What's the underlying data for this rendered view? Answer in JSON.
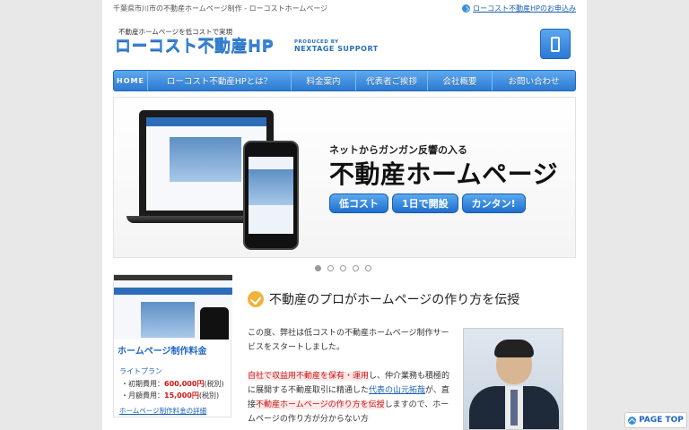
{
  "header": {
    "tagline": "千葉県市川市の不動産ホームページ制作 - ローコストホームページ",
    "apply_link": "ローコスト不動産HPのお申込み"
  },
  "logo": {
    "tag": "不動産ホームページを低コストで実現",
    "main": "ローコスト不動産HP",
    "partner_small": "PRODUCED BY",
    "partner_big": "NEXTAGE SUPPORT"
  },
  "nav": {
    "items": [
      {
        "label": "HOME"
      },
      {
        "label": "ローコスト不動産HPとは？"
      },
      {
        "label": "料金案内"
      },
      {
        "label": "代表者ご挨拶"
      },
      {
        "label": "会社概要"
      },
      {
        "label": "お問い合わせ"
      }
    ]
  },
  "hero": {
    "subtitle": "ネットからガンガン反響の入る",
    "title": "不動産ホームページ",
    "badges": [
      "低コスト",
      "1日で開設",
      "カンタン!"
    ]
  },
  "promo": {
    "title": "ホームページ制作料金",
    "plan": "ライトプラン",
    "initial_label": "・初期費用：",
    "initial_amount": "600,000円",
    "initial_tax": "(税別)",
    "monthly_label": "・月額費用：",
    "monthly_amount": "15,000円",
    "monthly_tax": "(税別)",
    "detail_link": "ホームページ制作料金の詳細"
  },
  "main": {
    "section_title": "不動産のプロがホームページの作り方を伝授",
    "p1": "この度、弊社は低コストの不動産ホームページ制作サービスをスタートしました。",
    "hl1": "自社で収益用不動産を保有・運用",
    "p2a": "し、仲介業務も積極的に展開する不動産取引に精通した",
    "link_rep": "代表の山元拓哉",
    "p2b": "が、直接",
    "hl2": "不動産ホームページの作り方を伝授",
    "p2c": "しますので、ホームページの作り方が分からない方"
  },
  "pagetop": {
    "label": "PAGE TOP"
  }
}
